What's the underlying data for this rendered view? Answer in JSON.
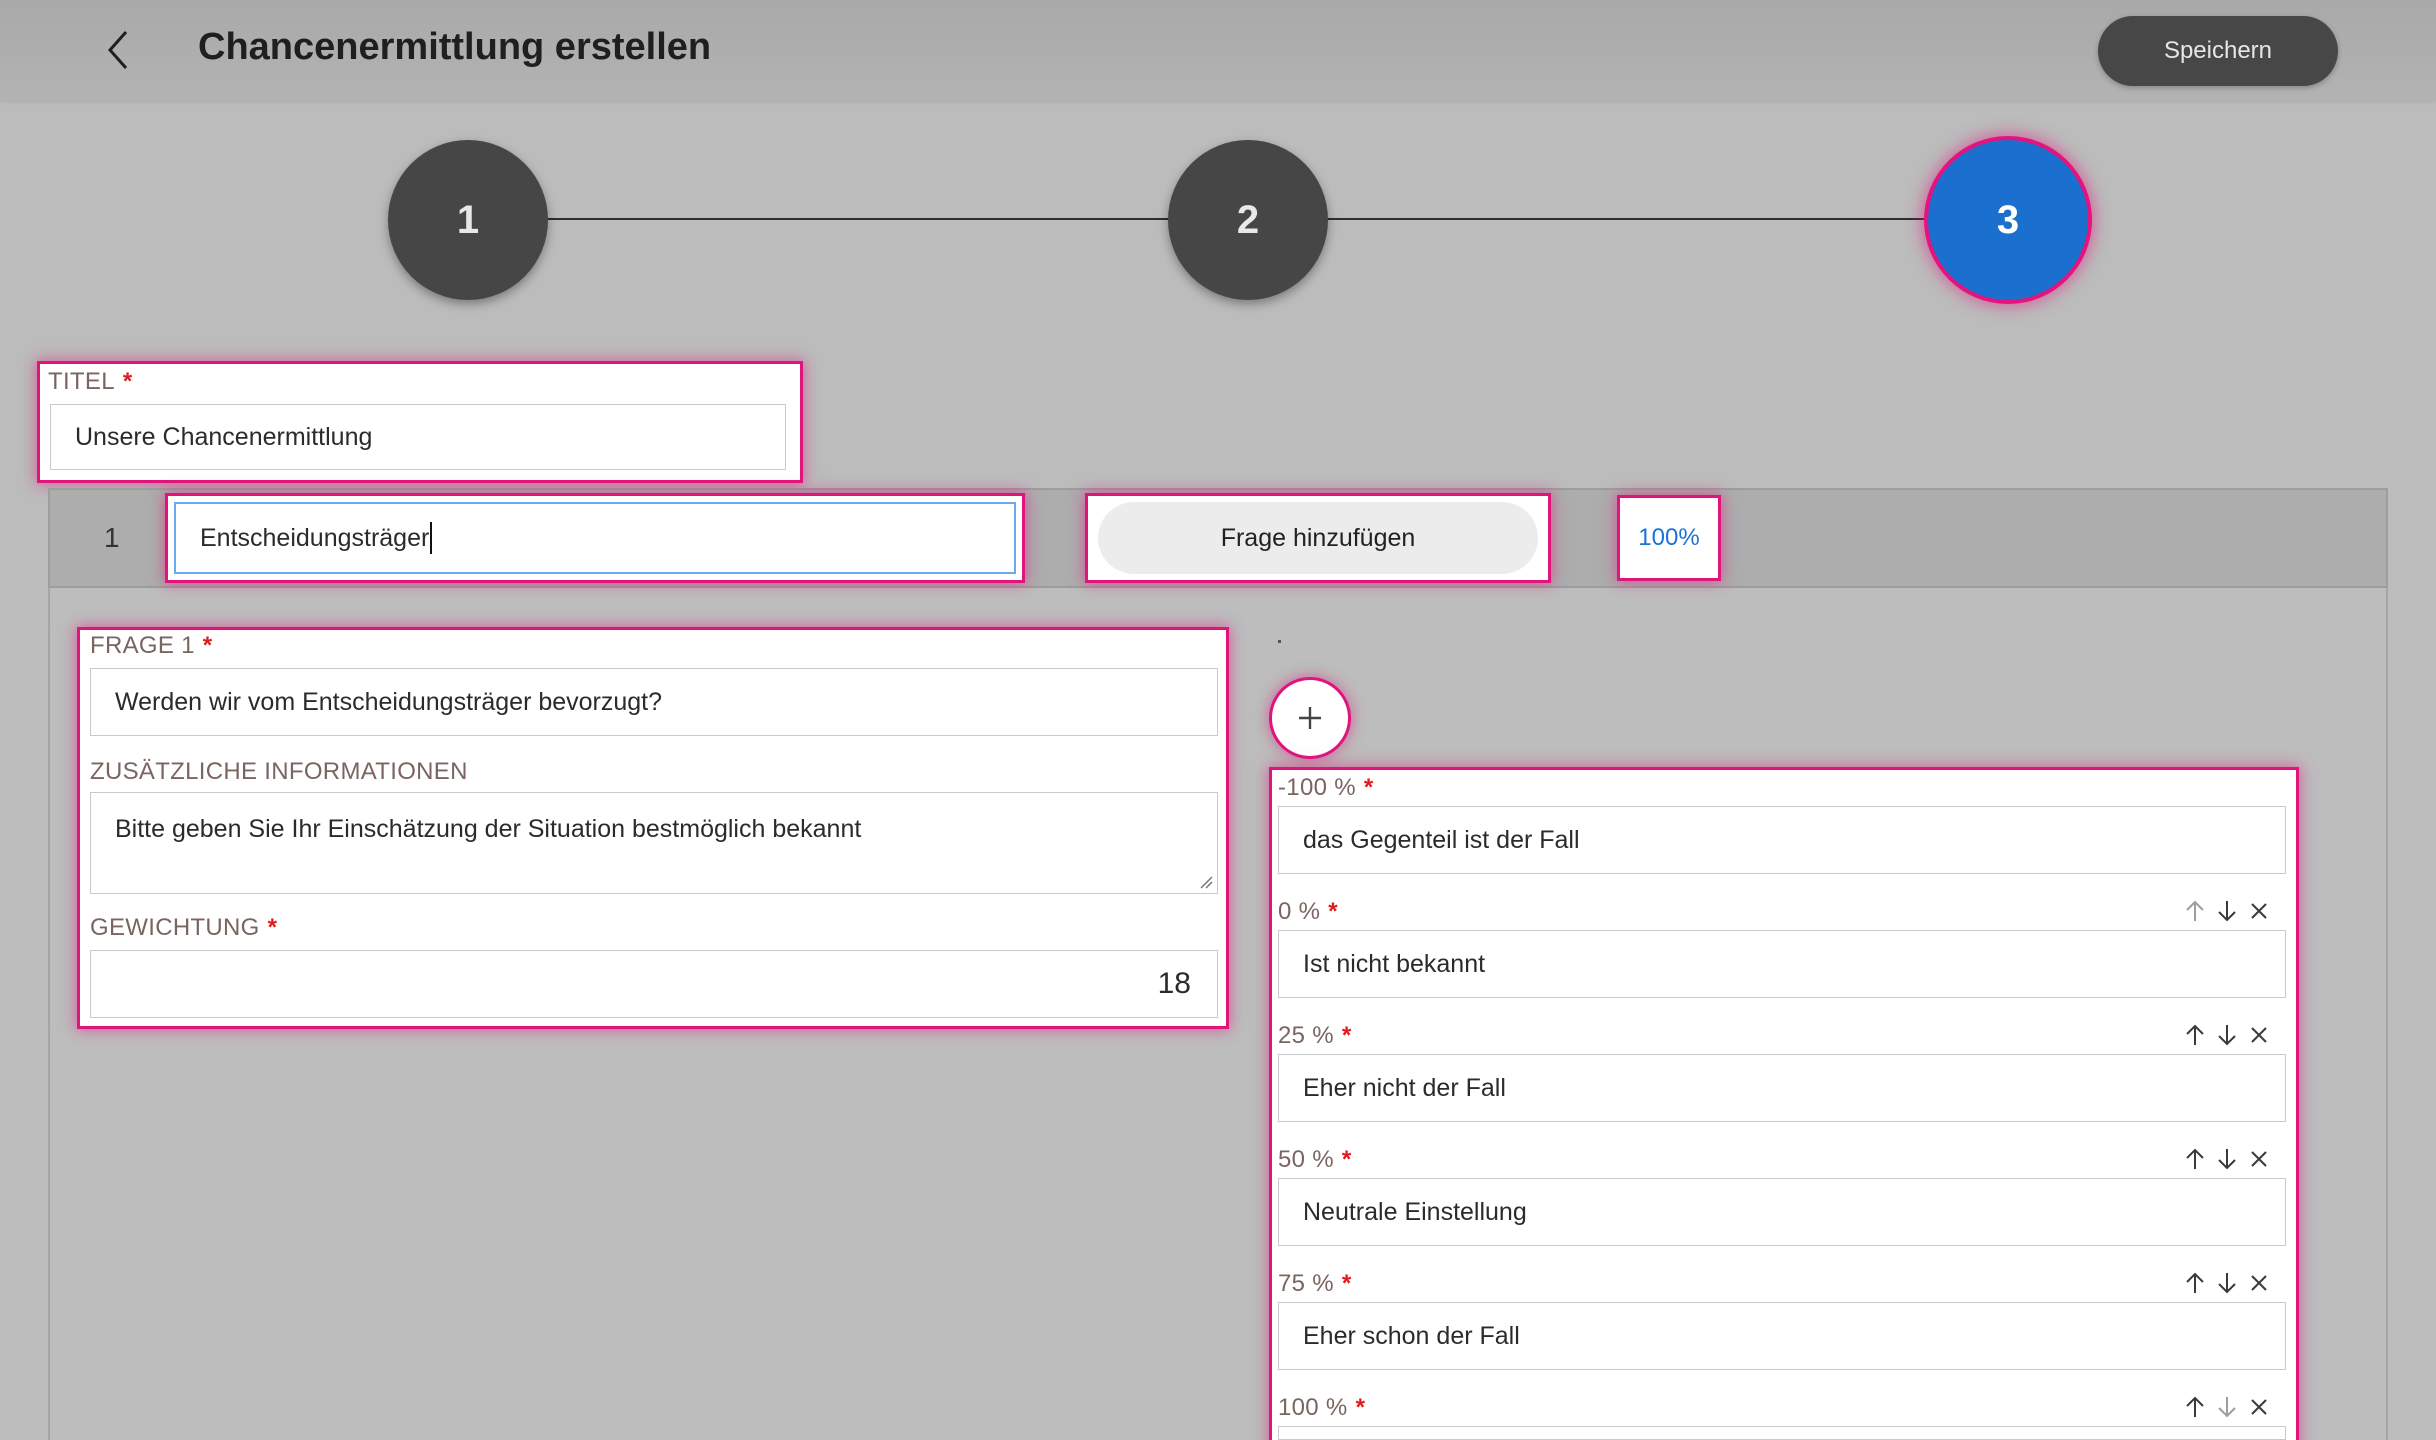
{
  "header": {
    "title": "Chancenermittlung erstellen",
    "save_label": "Speichern"
  },
  "steps": [
    "1",
    "2",
    "3"
  ],
  "active_step": "3",
  "title_field": {
    "label": "TITEL",
    "value": "Unsere Chancenermittlung"
  },
  "section": {
    "number": "1",
    "name_value": "Entscheidungsträger",
    "add_question_label": "Frage hinzufügen",
    "percent_label": "100%"
  },
  "question": {
    "label": "FRAGE 1",
    "value": "Werden wir vom Entscheidungsträger bevorzugt?",
    "info_label": "ZUSÄTZLICHE INFORMATIONEN",
    "info_value": "Bitte geben Sie Ihr Einschätzung der Situation bestmöglich bekannt",
    "weight_label": "GEWICHTUNG",
    "weight_value": "18"
  },
  "answers": [
    {
      "percent": "-100 %",
      "text": "das Gegenteil ist der Fall"
    },
    {
      "percent": "0 %",
      "text": "Ist nicht bekannt"
    },
    {
      "percent": "25 %",
      "text": "Eher nicht der Fall"
    },
    {
      "percent": "50 %",
      "text": "Neutrale Einstellung"
    },
    {
      "percent": "75 %",
      "text": "Eher schon der Fall"
    },
    {
      "percent": "100 %",
      "text": ""
    }
  ],
  "required_mark": "*",
  "colors": {
    "accent_blue": "#1a6fcf",
    "highlight": "#e0157c",
    "required": "#e01b1b"
  },
  "icons": {
    "back": "chevron-left-icon",
    "add": "plus-icon",
    "move_up": "arrow-up-icon",
    "move_down": "arrow-down-icon",
    "delete": "close-icon"
  }
}
